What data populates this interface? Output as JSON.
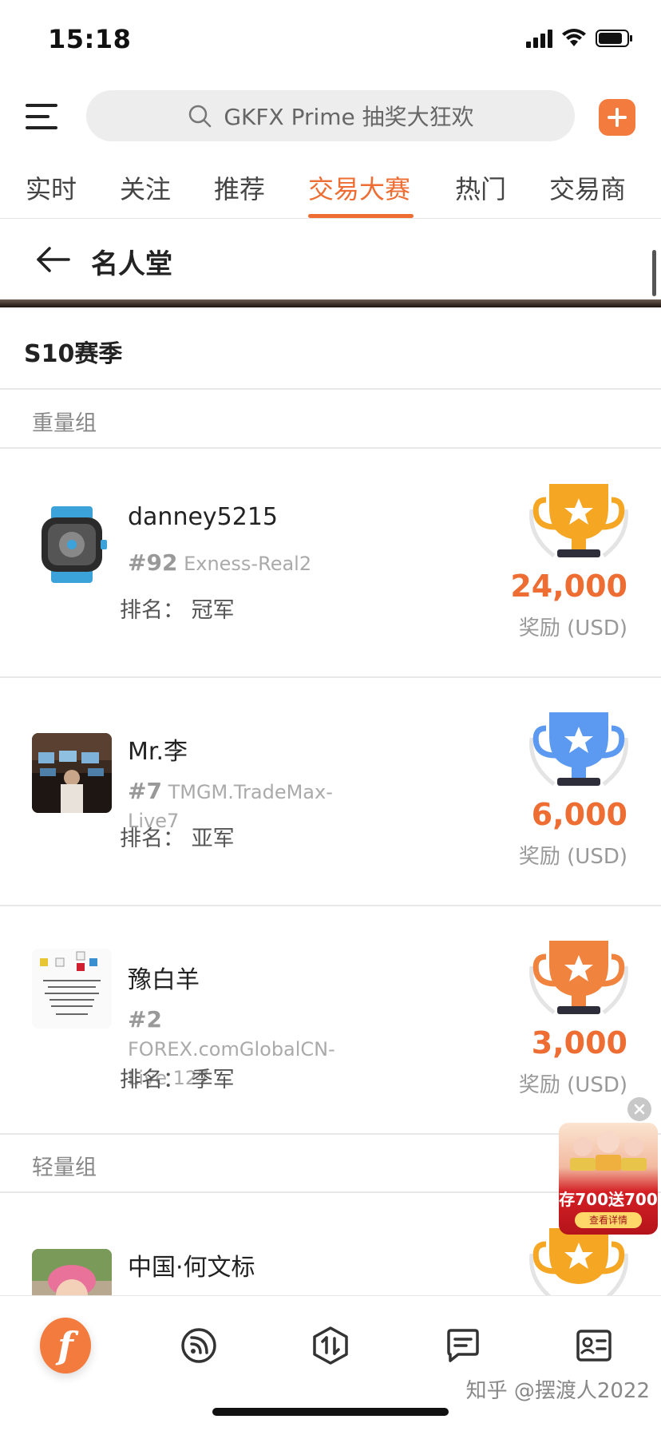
{
  "status_bar": {
    "time": "15:18"
  },
  "search": {
    "placeholder": "GKFX Prime 抽奖大狂欢"
  },
  "tabs": [
    {
      "label": "实时"
    },
    {
      "label": "关注"
    },
    {
      "label": "推荐"
    },
    {
      "label": "交易大赛",
      "active": true
    },
    {
      "label": "热门"
    },
    {
      "label": "交易商"
    }
  ],
  "page": {
    "title": "名人堂"
  },
  "season": {
    "title": "S10赛季"
  },
  "groups": {
    "heavy": {
      "label": "重量组"
    },
    "light": {
      "label": "轻量组"
    }
  },
  "rank_prefix": "排名：",
  "reward_label": "奖励 (USD)",
  "entries": [
    {
      "name": "danney5215",
      "number": "#92",
      "account": "Exness-Real2",
      "place": "冠军",
      "prize": "24,000",
      "trophy": "gold"
    },
    {
      "name": "Mr.李",
      "number": "#7",
      "account": "TMGM.TradeMax-Live7",
      "place": "亚军",
      "prize": "6,000",
      "trophy": "blue"
    },
    {
      "name": "豫白羊",
      "number": "#2",
      "account": "FOREX.comGlobalCN-Live 127",
      "place": "季军",
      "prize": "3,000",
      "trophy": "bronze"
    },
    {
      "name": "中国·何文标",
      "trophy": "gold"
    }
  ],
  "ad": {
    "text": "存700送700",
    "cta": "查看详情"
  },
  "watermark": "知乎 @摆渡人2022",
  "colors": {
    "accent": "#ee6d33",
    "gold": "#f5a623",
    "blue": "#5b9af0",
    "bronze": "#f0843f"
  }
}
